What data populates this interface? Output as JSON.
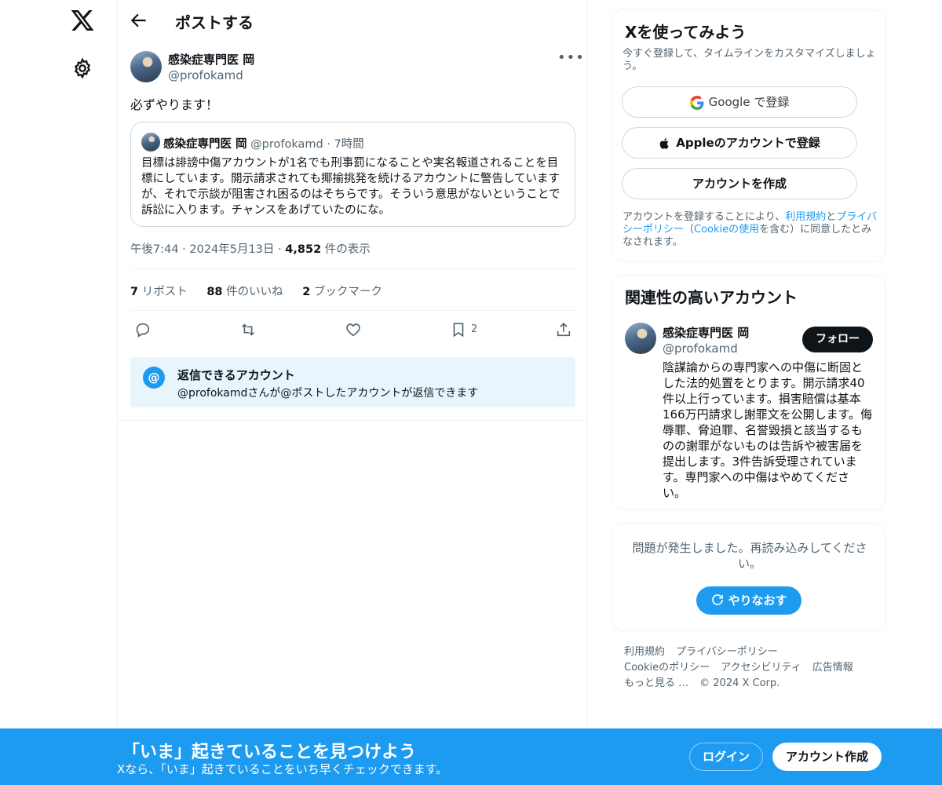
{
  "header": {
    "title": "ポストする"
  },
  "post": {
    "author_name": "感染症専門医 岡",
    "author_handle": "@profokamd",
    "text": "必ずやります！",
    "timestamp": "午後7:44 · 2024年5月13日 · ",
    "views_count": "4,852",
    "views_label": " 件の表示",
    "reposts_count": "7",
    "reposts_label": " リポスト",
    "likes_count": "88",
    "likes_label": " 件のいいね",
    "bookmarks_count": "2",
    "bookmarks_label": " ブックマーク",
    "bookmark_action_count": "2"
  },
  "quote": {
    "author_name": "感染症専門医 岡",
    "author_handle": "@profokamd",
    "separator": " · ",
    "time": "7時間",
    "text": "目標は誹謗中傷アカウントが1名でも刑事罰になることや実名報道されることを目標にしています。開示請求されても揶揄挑発を続けるアカウントに警告していますが、それで示談が阻害され困るのはそちらです。そういう意思がないということで訴訟に入ります。チャンスをあげていたのにな。"
  },
  "reply_restriction": {
    "title": "返信できるアカウント",
    "subtitle": "@profokamdさんが@ポストしたアカウントが返信できます"
  },
  "signup_card": {
    "title": "Xを使ってみよう",
    "subtitle": "今すぐ登録して、タイムラインをカスタマイズしましょう。",
    "google_label": "Google で登録",
    "apple_label": "Appleのアカウントで登録",
    "create_label": "アカウントを作成",
    "terms_pre": "アカウントを登録することにより、",
    "terms_link": "利用規約",
    "terms_mid": "と",
    "privacy_link": "プライバシーポリシー",
    "terms_mid2": "（",
    "cookie_link": "Cookieの使用",
    "terms_post": "を含む）に同意したとみなされます。"
  },
  "related": {
    "title": "関連性の高いアカウント",
    "name": "感染症専門医 岡",
    "handle": "@profokamd",
    "follow_label": "フォロー",
    "bio": "陰謀論からの専門家への中傷に断固とした法的処置をとります。開示請求40件以上行っています。損害賠償は基本166万円請求し謝罪文を公開します。侮辱罪、脅迫罪、名誉毀損と該当するものの謝罪がないものは告訴や被害届を提出します。3件告訴受理されています。専門家への中傷はやめてください。"
  },
  "error_card": {
    "message": "問題が発生しました。再読み込みしてください。",
    "retry_label": "やりなおす"
  },
  "footer": {
    "links": [
      "利用規約",
      "プライバシーポリシー",
      "Cookieのポリシー",
      "アクセシビリティ",
      "広告情報",
      "もっと見る …",
      "© 2024 X Corp."
    ]
  },
  "bottom_bar": {
    "title": "「いま」起きていることを見つけよう",
    "subtitle": "Xなら、「いま」起きていることをいち早くチェックできます。",
    "login_label": "ログイン",
    "signup_label": "アカウント作成"
  },
  "colors": {
    "accent": "#1d9bf0",
    "text": "#0f1419",
    "muted": "#536471"
  },
  "icons": [
    "x-logo-icon",
    "gear-icon",
    "back-arrow-icon",
    "more-icon",
    "reply-icon",
    "repost-icon",
    "like-icon",
    "bookmark-icon",
    "share-icon",
    "at-icon",
    "google-icon",
    "apple-icon",
    "refresh-icon"
  ]
}
